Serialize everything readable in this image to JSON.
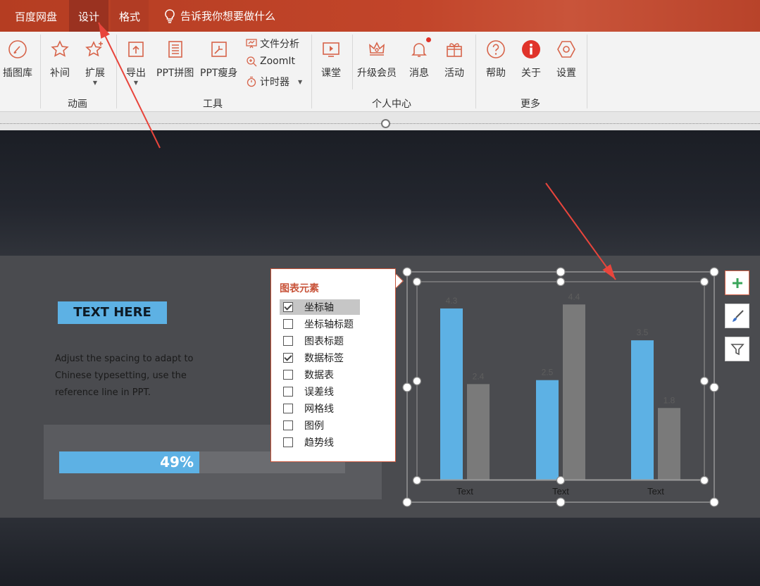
{
  "tabs": {
    "baidu": "百度网盘",
    "design": "设计",
    "format": "格式",
    "tell_me": "告诉我你想要做什么"
  },
  "ribbon": {
    "illustration": "插图库",
    "tween": "补间",
    "extend": "扩展",
    "group_animation": "动画",
    "export": "导出",
    "ppt_collage": "PPT拼图",
    "ppt_slim": "PPT瘦身",
    "file_analysis": "文件分析",
    "zoomit": "ZoomIt",
    "timer": "计时器",
    "group_tools": "工具",
    "classroom": "课堂",
    "upgrade_member": "升级会员",
    "messages": "消息",
    "activity": "活动",
    "group_personal": "个人中心",
    "help": "帮助",
    "about": "关于",
    "settings": "设置",
    "group_more": "更多"
  },
  "slide": {
    "heading": "TEXT HERE",
    "body": "Adjust the spacing to adapt to Chinese typesetting, use the reference line in PPT.",
    "progress": {
      "value": 0.49,
      "label": "49%"
    }
  },
  "chart_elements": {
    "title": "图表元素",
    "options": [
      {
        "label": "坐标轴",
        "checked": true,
        "highlighted": true
      },
      {
        "label": "坐标轴标题",
        "checked": false
      },
      {
        "label": "图表标题",
        "checked": false
      },
      {
        "label": "数据标签",
        "checked": true
      },
      {
        "label": "数据表",
        "checked": false
      },
      {
        "label": "误差线",
        "checked": false
      },
      {
        "label": "网格线",
        "checked": false
      },
      {
        "label": "图例",
        "checked": false
      },
      {
        "label": "趋势线",
        "checked": false
      }
    ]
  },
  "chart_data": {
    "type": "bar",
    "categories": [
      "Text",
      "Text",
      "Text"
    ],
    "series": [
      {
        "values": [
          4.3,
          2.5,
          3.5
        ],
        "color": "#5db1e4"
      },
      {
        "values": [
          2.4,
          4.4,
          1.8
        ],
        "color": "#7a7a7a"
      }
    ],
    "data_labels": true,
    "grid": false,
    "legend": "none",
    "ylim": [
      0,
      4.6
    ]
  },
  "colors": {
    "accent": "#c2452a",
    "blue": "#5db1e4",
    "gray": "#7a7a7a"
  }
}
